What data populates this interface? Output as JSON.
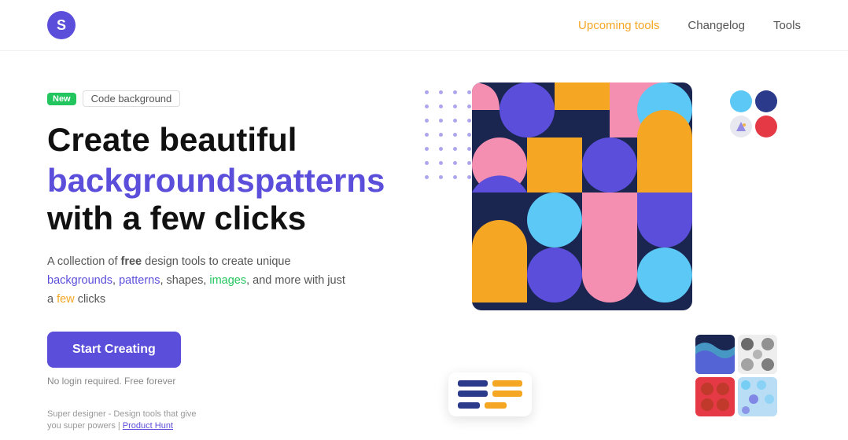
{
  "navbar": {
    "logo_letter": "S",
    "links": [
      {
        "label": "Upcoming tools",
        "active": true
      },
      {
        "label": "Changelog",
        "active": false
      },
      {
        "label": "Tools",
        "active": false
      }
    ]
  },
  "hero": {
    "badge_new": "New",
    "badge_label": "Code background",
    "title_line1": "Create beautiful",
    "title_colored": "backgroundspatterns",
    "title_line2": "with a few clicks",
    "description": "A collection of free design tools to create unique backgrounds, patterns, shapes, images, and more with just a few clicks",
    "cta_button": "Start Creating",
    "no_login_text": "No login required. Free forever",
    "product_hunt_text": "Super designer - Design tools that give you super powers | Product Hunt"
  },
  "colors": {
    "primary": "#5b4edb",
    "accent_orange": "#f5a623",
    "accent_green": "#22c55e",
    "accent_red": "#e63946",
    "dark_bg": "#1a2550"
  }
}
